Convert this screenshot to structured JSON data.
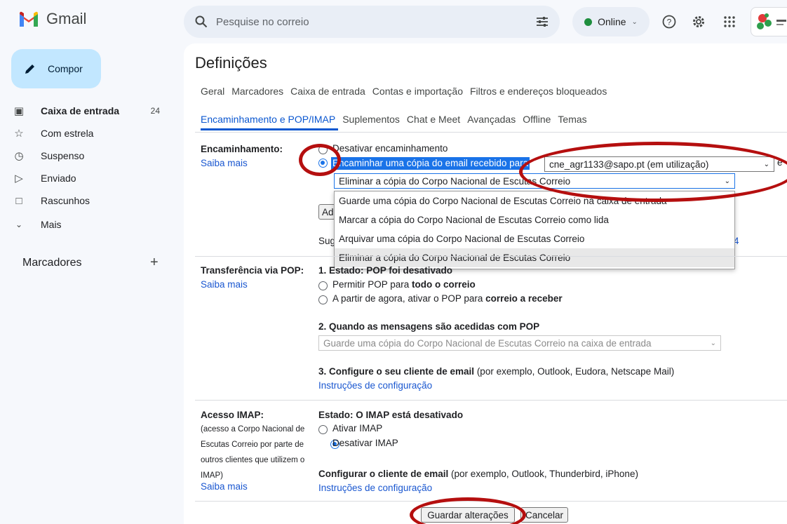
{
  "app": {
    "name": "Gmail"
  },
  "search": {
    "placeholder": "Pesquise no correio"
  },
  "status": {
    "label": "Online"
  },
  "sidebar": {
    "compose": "Compor",
    "items": [
      {
        "label": "Caixa de entrada",
        "count": "24"
      },
      {
        "label": "Com estrela",
        "count": ""
      },
      {
        "label": "Suspenso",
        "count": ""
      },
      {
        "label": "Enviado",
        "count": ""
      },
      {
        "label": "Rascunhos",
        "count": ""
      },
      {
        "label": "Mais",
        "count": ""
      }
    ],
    "labels_title": "Marcadores",
    "labels_add": "+"
  },
  "settings": {
    "title": "Definições",
    "tabs_row1": [
      "Geral",
      "Marcadores",
      "Caixa de entrada",
      "Contas e importação",
      "Filtros e endereços bloqueados"
    ],
    "tabs_row2": [
      "Encaminhamento e POP/IMAP",
      "Suplementos",
      "Chat e Meet",
      "Avançadas",
      "Offline",
      "Temas"
    ],
    "active_tab": "Encaminhamento e POP/IMAP"
  },
  "forwarding": {
    "label": "Encaminhamento:",
    "learn_more": "Saiba mais",
    "opt_disable": "Desativar encaminhamento",
    "opt_forward": "Encaminhar uma cópia do email recebido para",
    "forward_address": "cne_agr1133@sapo.pt (em utilização)",
    "trailing": "e",
    "action_selected": "Eliminar a cópia do Corpo Nacional de Escutas Correio",
    "add_button": "Ad",
    "tip_prefix": "Sug",
    "tip_suffix": "4",
    "action_options": [
      "Guarde uma cópia do Corpo Nacional de Escutas Correio na caixa de entrada",
      "Marcar a cópia do Corpo Nacional de Escutas Correio como lida",
      "Arquivar uma cópia do Corpo Nacional de Escutas Correio",
      "Eliminar a cópia do Corpo Nacional de Escutas Correio"
    ]
  },
  "pop": {
    "label": "Transferência via POP:",
    "learn_more": "Saiba mais",
    "status": "1. Estado: POP foi desativado",
    "opt_all_prefix": "Permitir POP para ",
    "opt_all_bold": "todo o correio",
    "opt_new_prefix": "A partir de agora, ativar o POP para ",
    "opt_new_bold": "correio a receber",
    "step2": "2. Quando as mensagens são acedidas com POP",
    "step2_select": "Guarde uma cópia do Corpo Nacional de Escutas Correio na caixa de entrada",
    "step3_bold": "3. Configure o seu cliente de email",
    "step3_rest": " (por exemplo, Outlook, Eudora, Netscape Mail)",
    "instructions": "Instruções de configuração"
  },
  "imap": {
    "label": "Acesso IMAP:",
    "desc_lines": [
      "(acesso a Corpo Nacional de",
      "Escutas Correio por parte de",
      "outros clientes que utilizem o",
      "IMAP)"
    ],
    "learn_more": "Saiba mais",
    "status": "Estado: O IMAP está desativado",
    "opt_enable": "Ativar IMAP",
    "opt_disable": "Desativar IMAP",
    "config_bold": "Configurar o cliente de email",
    "config_rest": " (por exemplo, Outlook, Thunderbird, iPhone)",
    "instructions": "Instruções de configuração"
  },
  "footer": {
    "save": "Guardar alterações",
    "cancel": "Cancelar"
  },
  "colors": {
    "accent": "#0b57d0",
    "highlight": "#b50f0f",
    "compose_bg": "#c2e7ff",
    "bg": "#f6f8fc"
  }
}
